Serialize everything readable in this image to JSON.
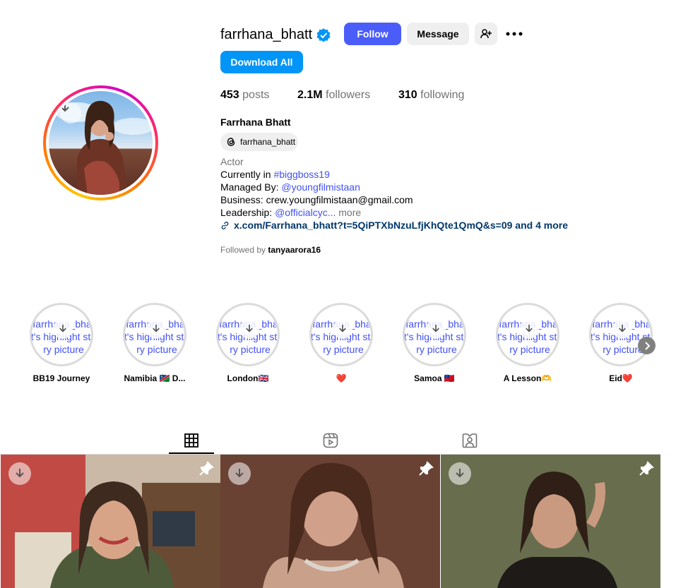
{
  "profile": {
    "username": "farrhana_bhatt",
    "full_name": "Farrhana Bhatt",
    "threads_handle": "farrhana_bhatt",
    "category": "Actor",
    "bio": {
      "line1_prefix": "Currently in ",
      "line1_link": "#biggboss19",
      "line2_prefix": "Managed By: ",
      "line2_link": "@youngfilmistaan",
      "line3": "Business: crew.youngfilmistaan@gmail.com",
      "line4_prefix": "Leadership: ",
      "line4_link": "@officialcyc...",
      "more": " more"
    },
    "external_link": "x.com/Farrhana_bhatt?t=5QiPTXbNzuLfjKhQte1QmQ&s=09 and 4 more",
    "followed_by_prefix": "Followed by ",
    "followed_by_user": "tanyaarora16"
  },
  "actions": {
    "follow": "Follow",
    "message": "Message",
    "download_all": "Download All"
  },
  "stats": {
    "posts_count": "453",
    "posts_label": "posts",
    "followers_count": "2.1M",
    "followers_label": "followers",
    "following_count": "310",
    "following_label": "following"
  },
  "highlights": {
    "alt_text": "farrhana_bhatt's highlight story picture",
    "items": [
      {
        "label": "BB19 Journey"
      },
      {
        "label": "Namibia 🇳🇦 D..."
      },
      {
        "label": "London🇬🇧"
      },
      {
        "label": "❤️"
      },
      {
        "label": "Samoa 🇼🇸"
      },
      {
        "label": "A Lesson🫶"
      },
      {
        "label": "Eid❤️"
      }
    ]
  },
  "tabs": [
    {
      "icon": "grid-icon",
      "active": true
    },
    {
      "icon": "reels-icon",
      "active": false
    },
    {
      "icon": "tagged-icon",
      "active": false
    }
  ],
  "colors": {
    "follow": "#4a5df9",
    "download_all": "#0095f6",
    "link": "#4150f7",
    "external_link": "#00376b"
  }
}
